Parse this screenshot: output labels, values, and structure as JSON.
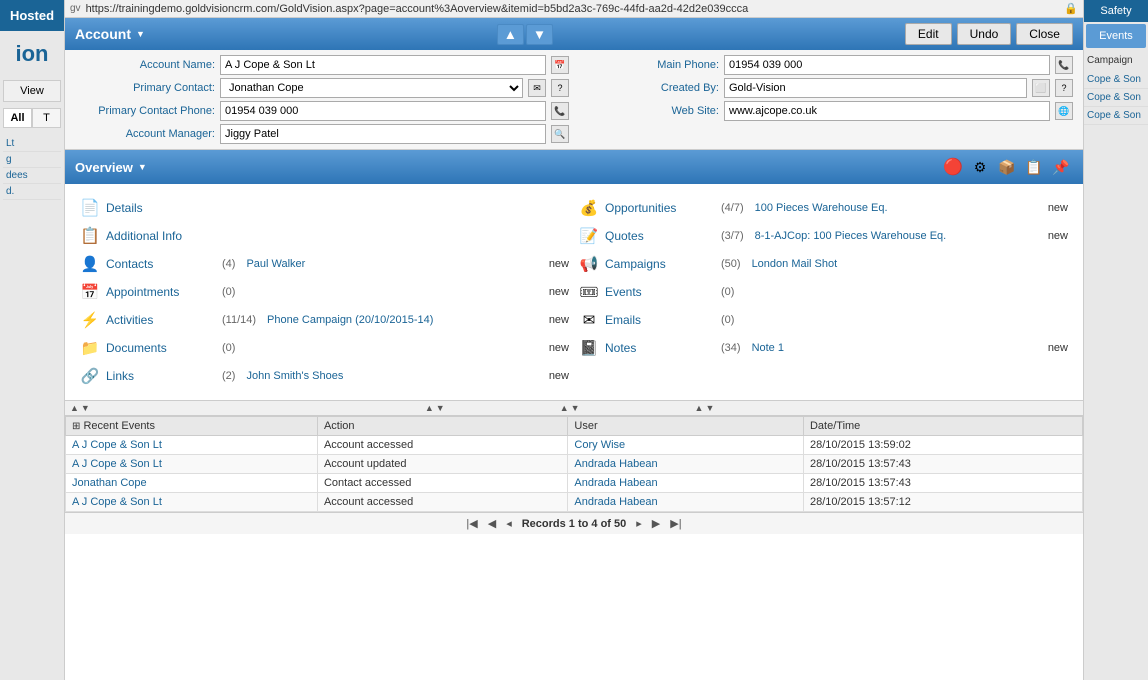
{
  "url": "https://trainingdemo.goldvisioncrm.com/GoldVision.aspx?page=account%3Aoverview&itemid=b5bd2a3c-769c-44fd-aa2d-42d2e039ccca",
  "left_sidebar": {
    "hosted_label": "Hosted",
    "logo": "ion",
    "view_btn": "View",
    "tabs": [
      "All",
      "T"
    ],
    "items": [
      "Lt",
      "g",
      "dees",
      "d."
    ]
  },
  "account": {
    "title": "Account",
    "edit_btn": "Edit",
    "undo_btn": "Undo",
    "close_btn": "Close",
    "account_name_label": "Account Name:",
    "account_name_value": "A J Cope & Son Lt",
    "main_phone_label": "Main Phone:",
    "main_phone_value": "01954 039 000",
    "primary_contact_label": "Primary Contact:",
    "primary_contact_value": "Jonathan Cope",
    "created_by_label": "Created By:",
    "created_by_value": "Gold-Vision",
    "primary_contact_phone_label": "Primary Contact Phone:",
    "primary_contact_phone_value": "01954 039 000",
    "web_site_label": "Web Site:",
    "web_site_value": "www.ajcope.co.uk",
    "account_manager_label": "Account Manager:",
    "account_manager_value": "Jiggy Patel"
  },
  "overview": {
    "title": "Overview",
    "sections": [
      {
        "col": "left",
        "label": "Details",
        "count": "",
        "link": "",
        "new_text": ""
      },
      {
        "col": "left",
        "label": "Additional Info",
        "count": "",
        "link": "",
        "new_text": ""
      },
      {
        "col": "left",
        "label": "Contacts",
        "count": "(4)",
        "link": "Paul Walker",
        "new_text": "new"
      },
      {
        "col": "right",
        "label": "Opportunities",
        "count": "(4/7)",
        "link": "100 Pieces Warehouse Eq.",
        "new_text": "new"
      },
      {
        "col": "left",
        "label": "Appointments",
        "count": "(0)",
        "link": "",
        "new_text": "new"
      },
      {
        "col": "right",
        "label": "Quotes",
        "count": "(3/7)",
        "link": "8-1-AJCop: 100 Pieces Warehouse Eq.",
        "new_text": "new"
      },
      {
        "col": "left",
        "label": "Activities",
        "count": "(11/14)",
        "link": "Phone Campaign (20/10/2015-14)",
        "new_text": "new"
      },
      {
        "col": "right",
        "label": "Campaigns",
        "count": "(50)",
        "link": "London Mail Shot",
        "new_text": ""
      },
      {
        "col": "left",
        "label": "Documents",
        "count": "(0)",
        "link": "",
        "new_text": "new"
      },
      {
        "col": "right",
        "label": "Events",
        "count": "(0)",
        "link": "",
        "new_text": ""
      },
      {
        "col": "left",
        "label": "Links",
        "count": "(2)",
        "link": "John Smith's Shoes",
        "new_text": "new"
      },
      {
        "col": "right",
        "label": "Emails",
        "count": "(0)",
        "link": "",
        "new_text": ""
      },
      {
        "col": "right",
        "label": "Notes",
        "count": "(34)",
        "link": "Note 1",
        "new_text": "new"
      }
    ]
  },
  "recent_events": {
    "header": "Recent Events",
    "columns": [
      "Action",
      "User",
      "Date/Time"
    ],
    "rows": [
      {
        "entity": "A J Cope & Son Lt",
        "action": "Account accessed",
        "user": "Cory Wise",
        "datetime": "28/10/2015 13:59:02"
      },
      {
        "entity": "A J Cope & Son Lt",
        "action": "Account updated",
        "user": "Andrada Habean",
        "datetime": "28/10/2015 13:57:43"
      },
      {
        "entity": "Jonathan Cope",
        "action": "Contact accessed",
        "user": "Andrada Habean",
        "datetime": "28/10/2015 13:57:43"
      },
      {
        "entity": "A J Cope & Son Lt",
        "action": "Account accessed",
        "user": "Andrada Habean",
        "datetime": "28/10/2015 13:57:12"
      }
    ],
    "pagination": "Records 1 to 4 of 50"
  },
  "right_sidebar": {
    "safety_label": "Safety",
    "events_btn": "Events",
    "campaign_label": "Campaign",
    "items": [
      "Cope & Son",
      "Cope & Son",
      "Cope & Son"
    ]
  }
}
